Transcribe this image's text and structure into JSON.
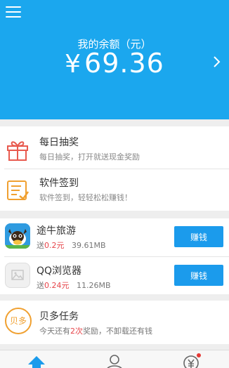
{
  "header": {
    "balance_label": "我的余额（元）",
    "currency_symbol": "¥",
    "balance_value": "69.36",
    "bg_color": "#1ba7ee"
  },
  "features": [
    {
      "title": "每日抽奖",
      "subtitle": "每日抽奖，打开就送现金奖励",
      "icon": "gift-icon"
    },
    {
      "title": "软件签到",
      "subtitle": "软件签到，轻轻松松赚钱！",
      "icon": "sign-in-icon"
    }
  ],
  "apps": [
    {
      "name": "途牛旅游",
      "reward_prefix": "送",
      "reward": "0.2元",
      "size": "39.61MB",
      "button": "赚钱",
      "icon": "tuniu-app-icon"
    },
    {
      "name": "QQ浏览器",
      "reward_prefix": "送",
      "reward": "0.24元",
      "size": "11.26MB",
      "button": "赚钱",
      "icon": "qq-browser-app-icon"
    }
  ],
  "beiduo": {
    "icon_text": "贝多",
    "title": "贝多任务",
    "sub_prefix": "今天还有",
    "sub_highlight": "2次",
    "sub_suffix": "奖励，不卸载还有钱"
  },
  "bottom_nav": [
    {
      "icon": "home-icon"
    },
    {
      "icon": "user-icon"
    },
    {
      "icon": "yuan-icon"
    }
  ],
  "colors": {
    "accent": "#1b9bec",
    "highlight": "#e6454a",
    "beiduo": "#f0a030"
  }
}
